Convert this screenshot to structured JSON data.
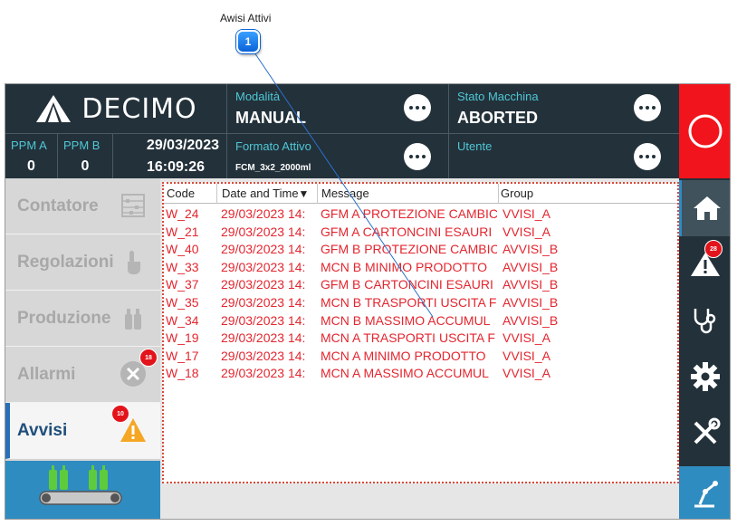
{
  "annotation": {
    "label": "Awisi Attivi",
    "number": "1"
  },
  "brand": {
    "name": "DECIMO"
  },
  "header": {
    "modalita": {
      "label": "Modalità",
      "value": "MANUAL"
    },
    "stato": {
      "label": "Stato Macchina",
      "value": "ABORTED"
    },
    "formato": {
      "label": "Formato Attivo",
      "value": "FCM_3x2_2000ml"
    },
    "utente": {
      "label": "Utente",
      "value": ""
    },
    "ppm_a": {
      "label": "PPM A",
      "value": "0"
    },
    "ppm_b": {
      "label": "PPM B",
      "value": "0"
    },
    "date": "29/03/2023",
    "time": "16:09:26"
  },
  "menu": {
    "items": [
      {
        "label": "Contatore",
        "icon": "abacus-icon"
      },
      {
        "label": "Regolazioni",
        "icon": "hand-pointer-icon"
      },
      {
        "label": "Produzione",
        "icon": "bottles-icon"
      },
      {
        "label": "Allarmi",
        "icon": "x-circle-icon",
        "badge": "18"
      },
      {
        "label": "Avvisi",
        "icon": "warning-icon",
        "badge": "10"
      }
    ]
  },
  "rail": {
    "alarm_badge": "28"
  },
  "table": {
    "headers": {
      "code": "Code",
      "date": "Date and Time",
      "message": "Message",
      "group": "Group"
    },
    "rows": [
      {
        "code": "W_24",
        "date": "29/03/2023 14:",
        "message": "GFM A PROTEZIONE CAMBIC",
        "group": "VVISI_A"
      },
      {
        "code": "W_21",
        "date": "29/03/2023 14:",
        "message": "GFM A CARTONCINI ESAURI",
        "group": "VVISI_A"
      },
      {
        "code": "W_40",
        "date": "29/03/2023 14:",
        "message": "GFM B PROTEZIONE CAMBIC",
        "group": "AVVISI_B"
      },
      {
        "code": "W_33",
        "date": "29/03/2023 14:",
        "message": "MCN B MINIMO PRODOTTO",
        "group": "AVVISI_B"
      },
      {
        "code": "W_37",
        "date": "29/03/2023 14:",
        "message": "GFM B CARTONCINI ESAURI",
        "group": "AVVISI_B"
      },
      {
        "code": "W_35",
        "date": "29/03/2023 14:",
        "message": "MCN B TRASPORTI USCITA F",
        "group": "AVVISI_B"
      },
      {
        "code": "W_34",
        "date": "29/03/2023 14:",
        "message": "MCN B MASSIMO ACCUMUL",
        "group": "AVVISI_B"
      },
      {
        "code": "W_19",
        "date": "29/03/2023 14:",
        "message": "MCN A TRASPORTI USCITA F",
        "group": "VVISI_A"
      },
      {
        "code": "W_17",
        "date": "29/03/2023 14:",
        "message": "MCN A MINIMO PRODOTTO",
        "group": "VVISI_A"
      },
      {
        "code": "W_18",
        "date": "29/03/2023 14:",
        "message": "MCN A MASSIMO ACCUMUL",
        "group": "VVISI_A"
      }
    ]
  },
  "colors": {
    "panel": "#23313a",
    "accent": "#4fc7d6",
    "alarm_red": "#f2141c",
    "row_text": "#e3262f",
    "active_blue": "#2a6fb5"
  }
}
